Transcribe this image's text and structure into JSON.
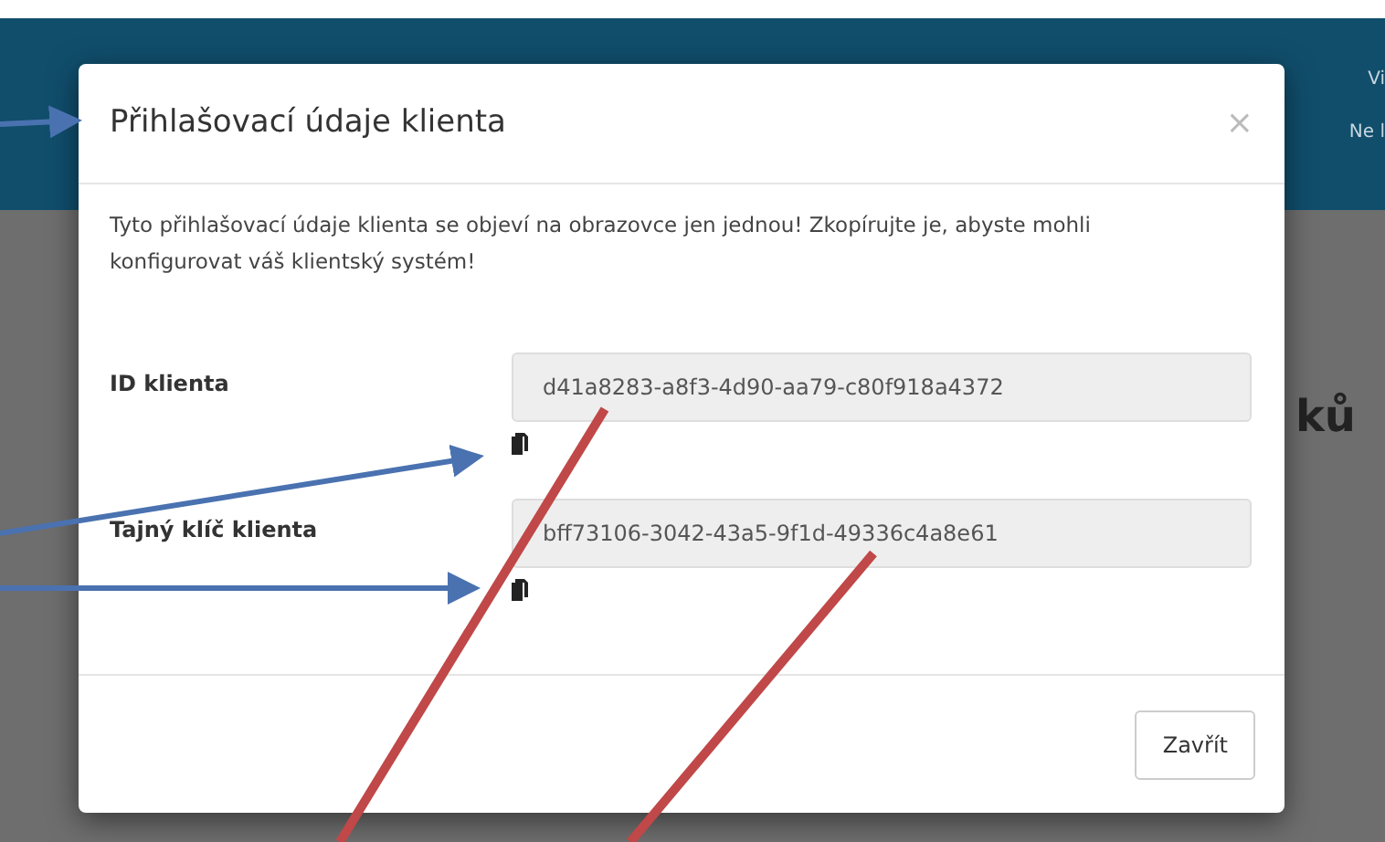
{
  "background": {
    "header_texts": [
      "Vi",
      "Ne l"
    ],
    "heading": "ků"
  },
  "dialog": {
    "title": "Přihlašovací údaje klienta",
    "close": "×",
    "message": "Tyto přihlašovací údaje klienta se objeví na obrazovce jen jednou! Zkopírujte je, abyste mohli konfigurovat váš klientský systém!",
    "fields": [
      {
        "label": "ID klienta",
        "value": "d41a8283-a8f3-4d90-aa79-c80f918a4372"
      },
      {
        "label": "Tajný klíč klienta",
        "value": "bff73106-3042-43a5-9f1d-49336c4a8e61"
      }
    ],
    "button": "Zavřít"
  }
}
